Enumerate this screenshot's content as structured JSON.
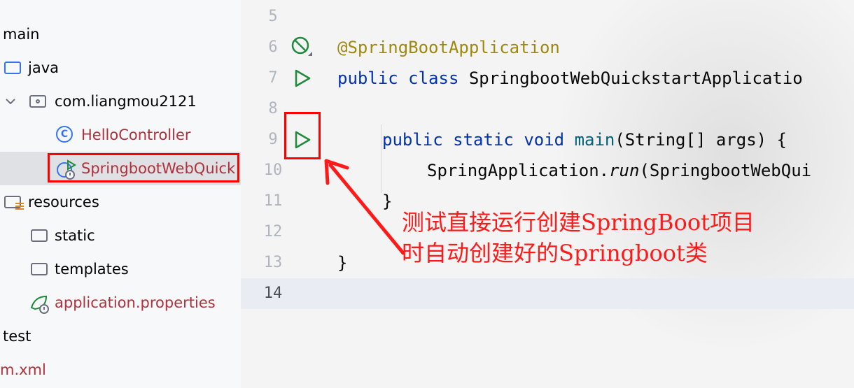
{
  "project_tree": {
    "items": [
      {
        "label": "main"
      },
      {
        "label": "java"
      },
      {
        "label": "com.liangmou2121"
      },
      {
        "label": "HelloController"
      },
      {
        "label": "SpringbootWebQuick"
      },
      {
        "label": "resources"
      },
      {
        "label": "static"
      },
      {
        "label": "templates"
      },
      {
        "label": "application.properties"
      },
      {
        "label": "test"
      },
      {
        "label": "m.xml"
      }
    ]
  },
  "editor": {
    "line_numbers": [
      "5",
      "6",
      "7",
      "8",
      "9",
      "10",
      "11",
      "12",
      "13",
      "14"
    ],
    "code": {
      "l6": "@SpringBootApplication",
      "l7_kw1": "public",
      "l7_kw2": "class",
      "l7_name": "SpringbootWebQuickstartApplicatio",
      "l9_kw1": "public",
      "l9_kw2": "static",
      "l9_kw3": "void",
      "l9_fn": "main",
      "l9_rest": "(String[] args) {",
      "l10_a": "SpringApplication.",
      "l10_b": "run",
      "l10_c": "(SpringbootWebQui",
      "l11": "}",
      "l13": "}"
    }
  },
  "annotation": {
    "line1": "测试直接运行创建SpringBoot项目",
    "line2": "时自动创建好的Springboot类"
  },
  "colors": {
    "keyword": "#0033b3",
    "annotation_code": "#9e880d",
    "method": "#00627a",
    "highlight_box": "#ff0000",
    "annotation_text": "#ff1a1a"
  }
}
